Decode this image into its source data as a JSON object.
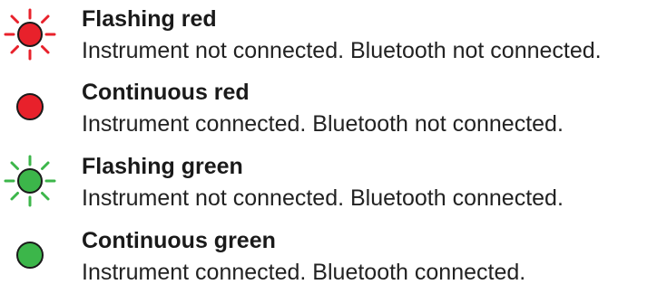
{
  "items": [
    {
      "title": "Flashing red",
      "description": "Instrument not connected. Bluetooth not connected.",
      "icon": "flashing-red-led-icon",
      "color": "#e8212b",
      "flashing": true
    },
    {
      "title": "Continuous red",
      "description": "Instrument connected. Bluetooth not connected.",
      "icon": "solid-red-led-icon",
      "color": "#e8212b",
      "flashing": false
    },
    {
      "title": "Flashing green",
      "description": "Instrument not connected. Bluetooth connected.",
      "icon": "flashing-green-led-icon",
      "color": "#3cb64a",
      "flashing": true
    },
    {
      "title": "Continuous green",
      "description": "Instrument connected. Bluetooth connected.",
      "icon": "solid-green-led-icon",
      "color": "#3cb64a",
      "flashing": false
    }
  ],
  "colors": {
    "outline": "#1a1a1a",
    "text": "#1a1a1a"
  }
}
